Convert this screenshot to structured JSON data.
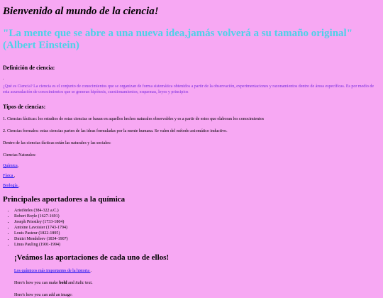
{
  "page": {
    "title": "Bienvenido al mundo de la ciencia!",
    "quote": "\"La mente que se abre a una nueva idea,jamás volverá a su tamaño original\" (Albert Einstein)",
    "definition_heading": "Definición de ciencia:",
    "definition_dot": ".",
    "definition_text": "¿Qué es Ciencia? La ciencia es el conjunto de conocimientos que se organizan de forma sistemática obtenidos a partir de la observación, experimentaciones y razonamientos dentro de áreas específicas. Es por medio de esta acumulación de conocimientos que se generan hipótesis, cuestionamientos, esquemas, leyes y principios",
    "types_heading": "Tipos de ciencias:",
    "types_1": "1. Ciencias fácticas: los estudios de estas ciencias se basan en aquellos hechos naturales observables y es a partir de estos que elaboran los conocimientos",
    "types_2": "2. Ciencias formales: estas ciencias parten de las ideas formuladas por la mente humana. Se valen del método axiomático inductivo.",
    "factual_intro": "Dentro de las ciencias fácticas están las naturales y las sociales:",
    "natural_label": "Ciencias Naturales:",
    "links": {
      "quimica": "Química",
      "quimica_suffix": ",",
      "fisica": "Física ",
      "fisica_suffix": ",",
      "biologia": "Biología ",
      "biologia_suffix": "."
    },
    "contributors_heading": "Principales aportadores a la química",
    "contributors": [
      "Aristóteles (384-322 a.C.)",
      "Robert Boyle (1627-1691)",
      "Joseph Priestley (1733-1804)",
      "Antoine Lavoisier (1743-1794)",
      "Louis Pasteur (1822-1895)",
      "Dmitri Mendeleev (1834-1907)",
      "Linus Pauling (1901-1994)"
    ],
    "section_heading": "¡Veámos las aportaciones de cada uno de ellos!",
    "section_link": "Los químicos más importantes de la historia ",
    "section_link_suffix": ".",
    "bold_line_prefix": "Here's how you can make ",
    "bold_word": "bold",
    "bold_and": " and ",
    "italic_word": "italic",
    "bold_line_suffix": " text.",
    "image_line": "Here's how you can add an image:"
  },
  "colors": {
    "background": "#f7a8f3",
    "quote": "#4dd2e8",
    "definition": "#7a2be0",
    "link": "#0000ee"
  }
}
